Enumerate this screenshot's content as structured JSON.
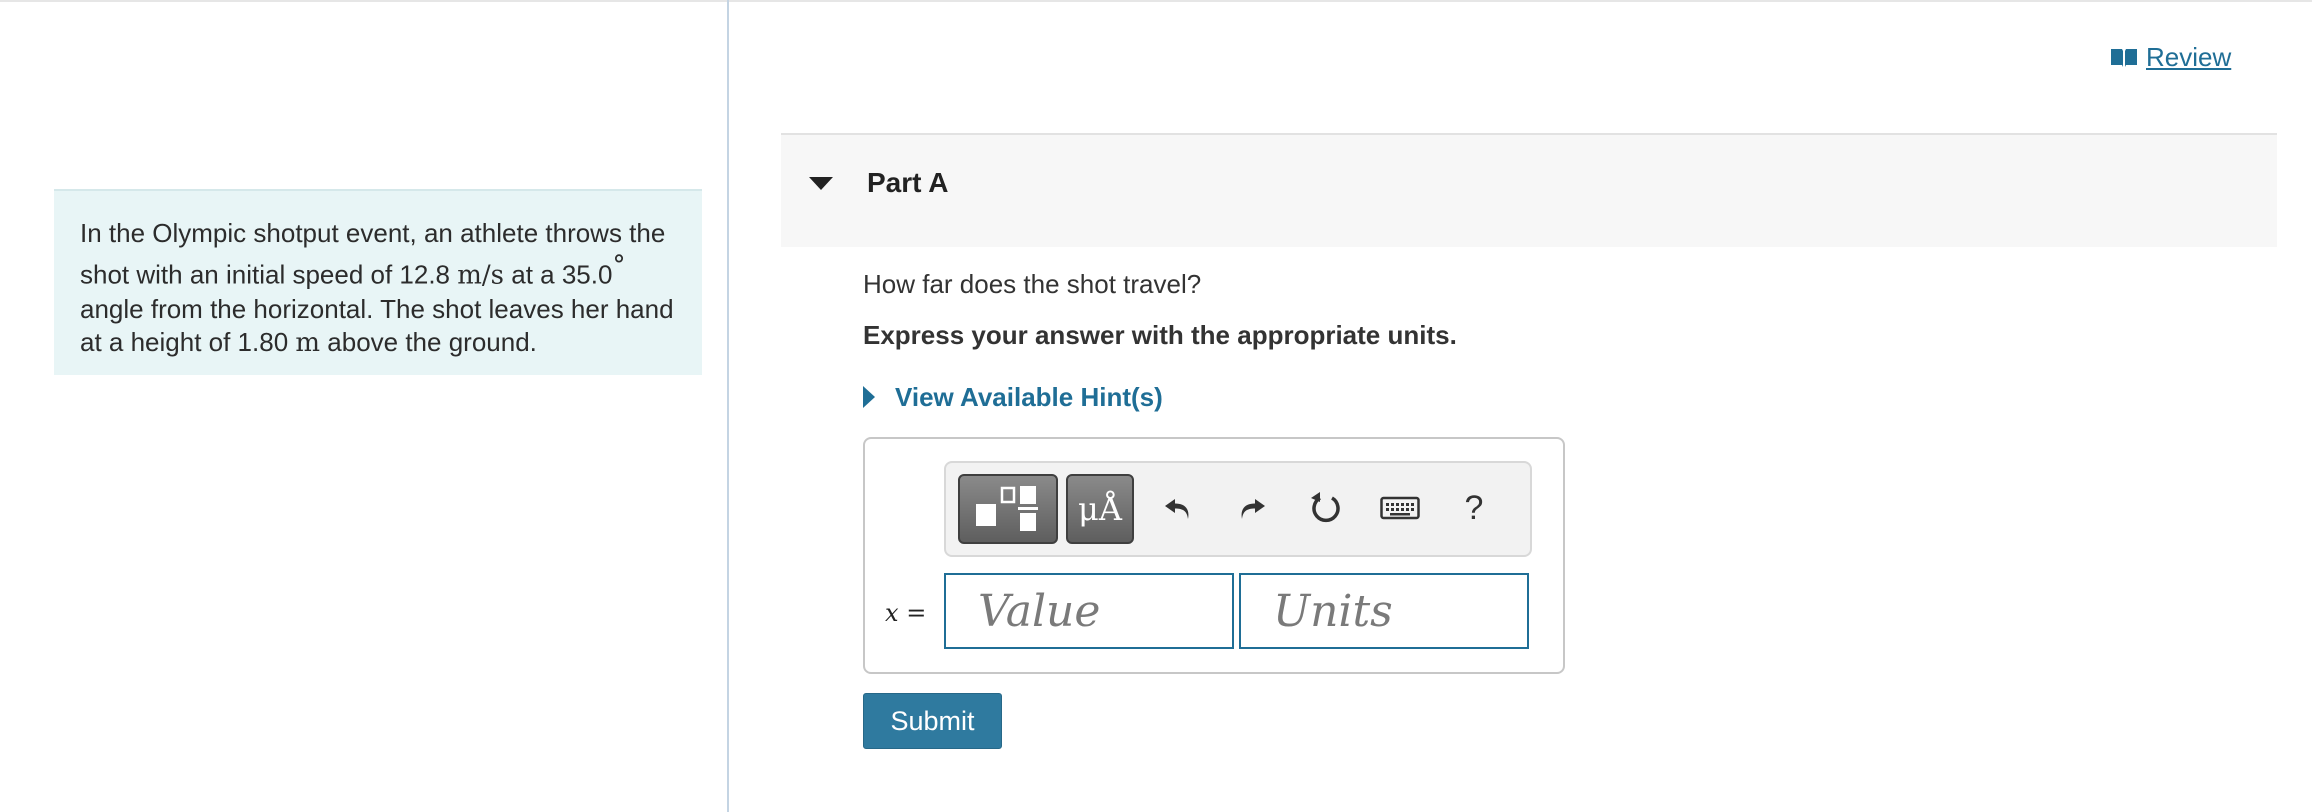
{
  "problem": {
    "text_parts": [
      "In the Olympic shotput event, an athlete throws the shot with an initial speed of 12.8 ",
      "m/s",
      " at a 35.0",
      "°",
      " angle from the horizontal. The shot leaves her hand at a height of 1.80 ",
      "m",
      " above the ground."
    ]
  },
  "review": {
    "label": "Review",
    "icon": "book-icon"
  },
  "part": {
    "title": "Part A",
    "collapse_icon": "caret-down-icon"
  },
  "question": {
    "prompt": "How far does the shot travel?",
    "instruction": "Express your answer with the appropriate units."
  },
  "hint": {
    "label": "View Available Hint(s)",
    "icon": "caret-right-icon"
  },
  "toolbar": {
    "templates_icon": "templates-icon",
    "units_label": "μÅ",
    "undo_icon": "undo-icon",
    "redo_icon": "redo-icon",
    "reset_icon": "reset-icon",
    "keyboard_icon": "keyboard-icon",
    "help_label": "?"
  },
  "answer": {
    "variable": "x",
    "equals": "=",
    "value_placeholder": "Value",
    "units_placeholder": "Units"
  },
  "submit": {
    "label": "Submit"
  },
  "colors": {
    "accent": "#1f6e96",
    "submit": "#2f7a9f",
    "problem_bg": "#e8f5f6",
    "part_header_bg": "#f7f7f7"
  }
}
